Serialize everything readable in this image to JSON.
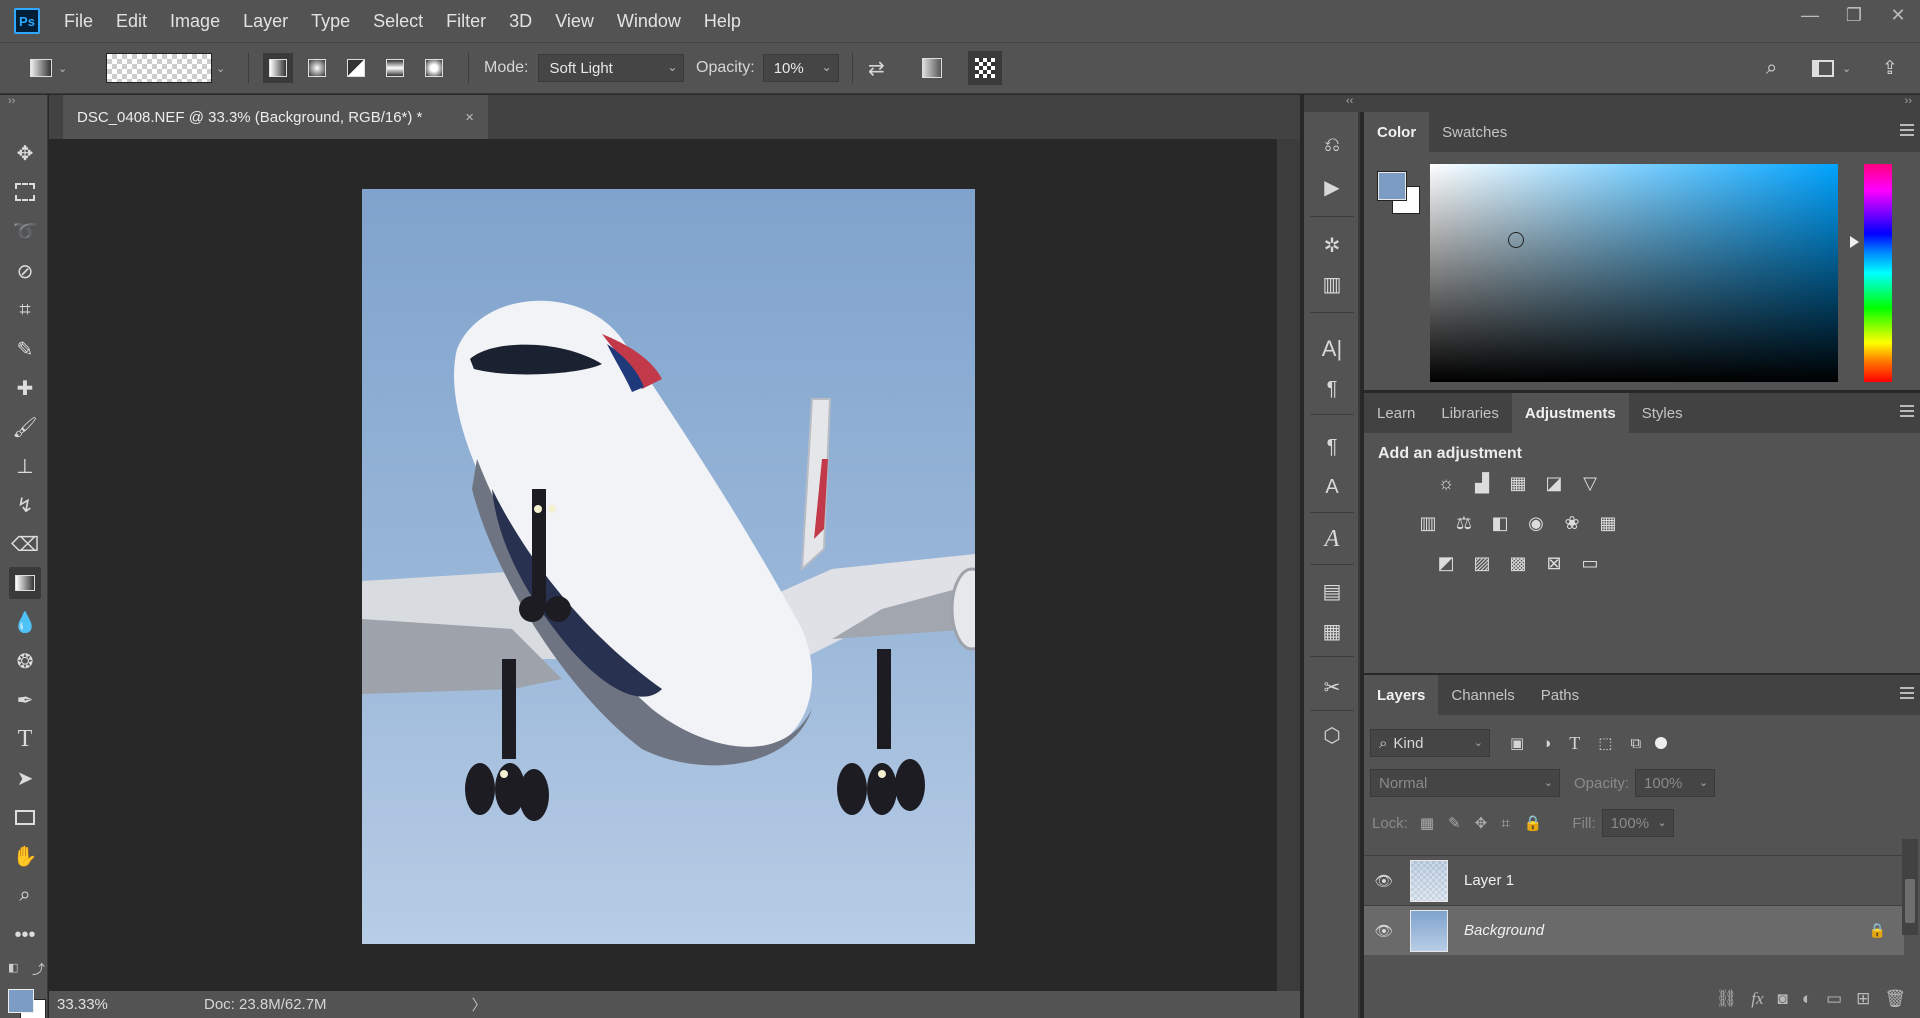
{
  "app": {
    "logo": "Ps"
  },
  "menu": [
    "File",
    "Edit",
    "Image",
    "Layer",
    "Type",
    "Select",
    "Filter",
    "3D",
    "View",
    "Window",
    "Help"
  ],
  "window_controls": {
    "minimize": "—",
    "restore": "❐",
    "close": "✕"
  },
  "options": {
    "mode_label": "Mode:",
    "mode_value": "Soft Light",
    "opacity_label": "Opacity:",
    "opacity_value": "10%"
  },
  "document": {
    "tab_title": "DSC_0408.NEF @ 33.3% (Background, RGB/16*) *",
    "close": "×",
    "zoom": "33.33%",
    "doc_size": "Doc: 23.8M/62.7M",
    "status_arrow": "〉"
  },
  "color_panel": {
    "tabs": [
      "Color",
      "Swatches"
    ],
    "foreground": "#7c9cc4",
    "background": "#ffffff",
    "hue": "#00a3ff"
  },
  "adjustments_panel": {
    "tabs": [
      "Learn",
      "Libraries",
      "Adjustments",
      "Styles"
    ],
    "title": "Add an adjustment",
    "row1": [
      "brightness-contrast-icon",
      "levels-icon",
      "curves-icon",
      "exposure-icon",
      "gradient-triangle-icon"
    ],
    "row2": [
      "vibrance-icon",
      "color-balance-icon",
      "black-white-icon",
      "photo-filter-icon",
      "channel-mixer-icon",
      "color-lookup-icon"
    ],
    "row3": [
      "invert-icon",
      "posterize-icon",
      "threshold-icon",
      "selective-color-icon",
      "gradient-map-icon"
    ]
  },
  "layers_panel": {
    "tabs": [
      "Layers",
      "Channels",
      "Paths"
    ],
    "filter_kind": "Kind",
    "blend_mode": "Normal",
    "opacity_label": "Opacity:",
    "opacity_value": "100%",
    "lock_label": "Lock:",
    "fill_label": "Fill:",
    "fill_value": "100%",
    "layers": [
      {
        "name": "Layer 1",
        "visible": true,
        "selected": false,
        "locked": false
      },
      {
        "name": "Background",
        "visible": true,
        "selected": true,
        "locked": true
      }
    ]
  }
}
